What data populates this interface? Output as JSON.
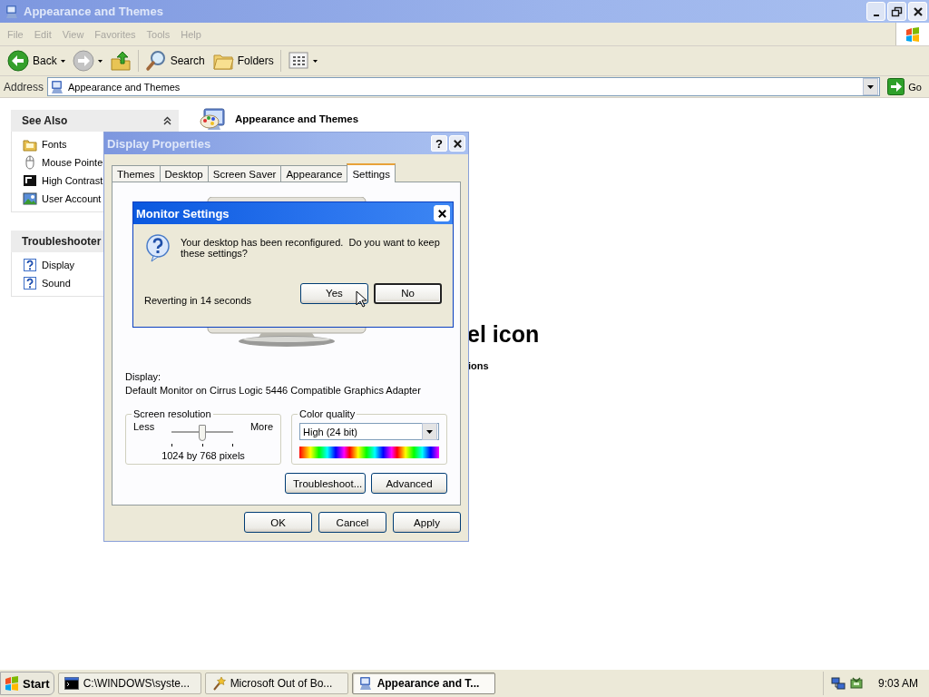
{
  "window": {
    "title": "Appearance and Themes",
    "active": false
  },
  "menu": [
    "File",
    "Edit",
    "View",
    "Favorites",
    "Tools",
    "Help"
  ],
  "toolbar": [
    {
      "kind": "back",
      "label": "Back",
      "dropdown": true
    },
    {
      "kind": "forward",
      "dropdown": true
    },
    {
      "kind": "up"
    },
    {
      "kind": "search",
      "label": "Search"
    },
    {
      "kind": "folders",
      "label": "Folders"
    },
    {
      "kind": "views",
      "dropdown": true
    }
  ],
  "address": {
    "label": "Address",
    "value": "Appearance and Themes",
    "go": "Go"
  },
  "task_pane": [
    {
      "title": "See Also",
      "expanded": true,
      "items": [
        {
          "kind": "fonts",
          "label": "Fonts"
        },
        {
          "kind": "mouse",
          "label": "Mouse Pointe"
        },
        {
          "kind": "contrast",
          "label": "High Contrast"
        },
        {
          "kind": "user",
          "label": "User Account"
        }
      ]
    },
    {
      "title": "Troubleshooter",
      "items": [
        {
          "kind": "help",
          "label": "Display"
        },
        {
          "kind": "help",
          "label": "Sound"
        }
      ]
    }
  ],
  "main": {
    "heading": "Appearance and Themes",
    "heading_fragment": "el icon",
    "link_fragment": "ions"
  },
  "display_properties": {
    "title": "Display Properties",
    "active": false,
    "help": "?",
    "tabs": [
      {
        "label": "Themes",
        "selected": false
      },
      {
        "label": "Desktop",
        "selected": false
      },
      {
        "label": "Screen Saver",
        "selected": false
      },
      {
        "label": "Appearance",
        "selected": false
      },
      {
        "label": "Settings",
        "selected": true
      }
    ],
    "display_label": "Display:",
    "display_name": "Default Monitor on Cirrus Logic 5446 Compatible Graphics Adapter",
    "resolution": {
      "title": "Screen resolution",
      "min_label": "Less",
      "max_label": "More",
      "level": 0.5,
      "reading": "1024 by 768 pixels"
    },
    "color_quality": {
      "title": "Color quality",
      "value": "High (24 bit)"
    },
    "panel_buttons": [
      "Troubleshoot...",
      "Advanced"
    ],
    "buttons": [
      "OK",
      "Cancel",
      "Apply"
    ]
  },
  "monitor_settings": {
    "title": "Monitor Settings",
    "active": true,
    "message": "Your desktop has been reconfigured.  Do you want to keep these settings?",
    "countdown": "Reverting in 14 seconds",
    "buttons": [
      {
        "label": "Yes",
        "focused": false
      },
      {
        "label": "No",
        "focused": true
      }
    ]
  },
  "taskbar": {
    "start": "Start",
    "tasks": [
      {
        "kind": "console",
        "label": "C:\\WINDOWS\\syste...",
        "selected": false
      },
      {
        "kind": "wizard",
        "label": "Microsoft Out of Bo...",
        "selected": false
      },
      {
        "kind": "folder",
        "label": "Appearance and T...",
        "selected": true
      }
    ],
    "clock": "9:03 AM"
  }
}
